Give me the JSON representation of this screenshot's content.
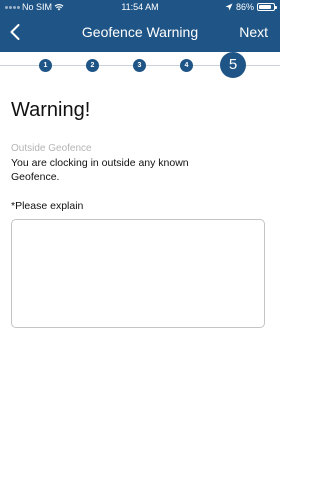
{
  "status_bar": {
    "carrier": "No SIM",
    "time": "11:54 AM",
    "battery": "86%",
    "battery_level": 0.86,
    "icons": [
      "wifi-icon",
      "location-arrow-icon",
      "battery-icon"
    ]
  },
  "nav": {
    "title": "Geofence Warning",
    "back_icon": "chevron-left-icon",
    "next_label": "Next"
  },
  "stepper": {
    "steps": [
      "1",
      "2",
      "3",
      "4",
      "5"
    ],
    "current": 5
  },
  "content": {
    "title": "Warning!",
    "reason_label": "Outside Geofence",
    "message": "You are clocking in outside any known Geofence.",
    "explain_label": "*Please explain",
    "explain_value": "",
    "explain_placeholder": ""
  },
  "colors": {
    "header": "#1f5586",
    "step": "#1f5586",
    "muted_text": "#b5b5b5"
  }
}
